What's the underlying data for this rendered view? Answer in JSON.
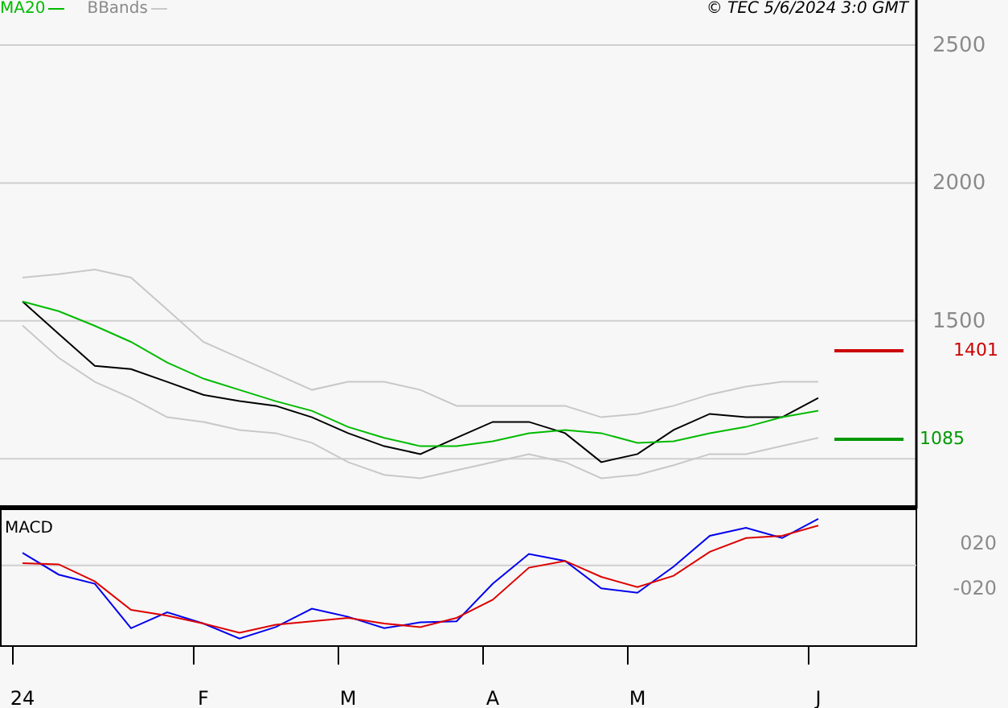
{
  "copyright": "© TEC 5/6/2024 3:0 GMT",
  "price_chart": {
    "chart_data": {
      "type": "line",
      "grid": true,
      "series": [
        {
          "color": "#000000",
          "values": [
            1570,
            1453,
            1337,
            1325,
            1279,
            1232,
            1209,
            1192,
            1151,
            1093,
            1046,
            1017,
            1076,
            1134,
            1134,
            1093,
            988,
            1017,
            1105,
            1163,
            1151,
            1151,
            1221
          ]
        },
        {
          "name": "MA20",
          "color": "#00bb00",
          "values": [
            1570,
            1535,
            1482,
            1424,
            1349,
            1291,
            1250,
            1209,
            1174,
            1116,
            1076,
            1046,
            1046,
            1064,
            1093,
            1105,
            1093,
            1058,
            1064,
            1093,
            1116,
            1151,
            1174
          ]
        },
        {
          "name": "BBands",
          "color": "#c8c8c8",
          "values": [
            1657,
            1669,
            1686,
            1657,
            1541,
            1424,
            1366,
            1308,
            1250,
            1279,
            1279,
            1250,
            1192,
            1192,
            1192,
            1192,
            1151,
            1163,
            1192,
            1233,
            1262,
            1279,
            1279
          ]
        },
        {
          "color": "#c8c8c8",
          "values": [
            1483,
            1366,
            1279,
            1221,
            1151,
            1134,
            1105,
            1093,
            1058,
            988,
            942,
            930,
            959,
            988,
            1017,
            988,
            930,
            942,
            977,
            1017,
            1017,
            1047,
            1076
          ]
        }
      ],
      "ylim": [
        826,
        2663
      ],
      "yticks": [
        1500,
        2000,
        2500
      ]
    },
    "level_markers": [
      {
        "label": "1401",
        "color": "#cc0000"
      },
      {
        "label": "1085",
        "color": "#009900"
      }
    ]
  },
  "macd_chart": {
    "chart_data": {
      "type": "line",
      "title": "MACD",
      "categories": [
        "24",
        null,
        null,
        null,
        null,
        "F",
        null,
        null,
        null,
        "M",
        null,
        null,
        null,
        "A",
        null,
        null,
        null,
        "M",
        null,
        null,
        null,
        null,
        "J"
      ],
      "series": [
        {
          "color": "#0000ee",
          "values": [
            11,
            -8,
            -16,
            -55,
            -41,
            -51,
            -64,
            -54,
            -38,
            -45,
            -55,
            -50,
            -49,
            -16,
            10,
            4,
            -20,
            -24,
            -1,
            26,
            33,
            24,
            41
          ]
        },
        {
          "color": "#dd0000",
          "values": [
            2,
            1,
            -14,
            -39,
            -44,
            -51,
            -59,
            -52,
            -49,
            -46,
            -51,
            -54,
            -46,
            -30,
            -2,
            4,
            -10,
            -19,
            -9,
            12,
            24,
            26,
            35
          ]
        }
      ],
      "ylim": [
        -70,
        50
      ],
      "yticks": [
        {
          "value": 20,
          "label": "020"
        },
        {
          "value": -20,
          "label": "-020"
        }
      ]
    }
  }
}
